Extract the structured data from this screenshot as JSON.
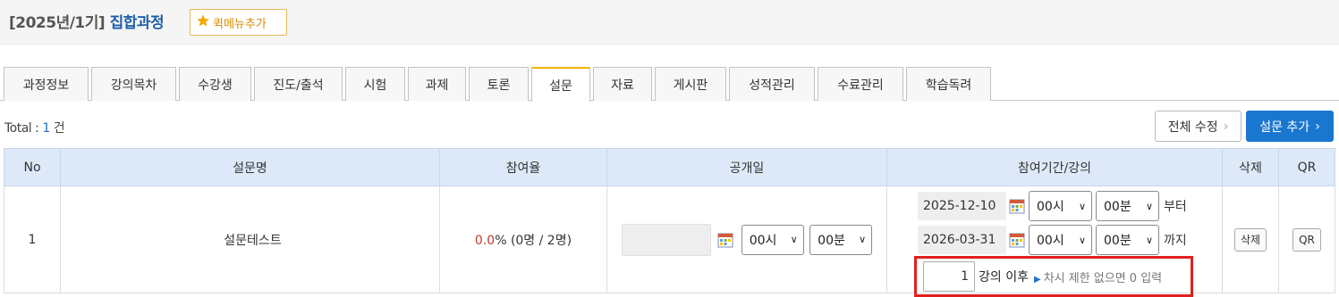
{
  "header": {
    "term": "[2025년/1기]",
    "course": "집합과정",
    "quick_menu_label": "퀵메뉴추가"
  },
  "tabs": [
    {
      "label": "과정정보",
      "active": false
    },
    {
      "label": "강의목차",
      "active": false
    },
    {
      "label": "수강생",
      "active": false
    },
    {
      "label": "진도/출석",
      "active": false
    },
    {
      "label": "시험",
      "active": false
    },
    {
      "label": "과제",
      "active": false
    },
    {
      "label": "토론",
      "active": false
    },
    {
      "label": "설문",
      "active": true
    },
    {
      "label": "자료",
      "active": false
    },
    {
      "label": "게시판",
      "active": false
    },
    {
      "label": "성적관리",
      "active": false
    },
    {
      "label": "수료관리",
      "active": false
    },
    {
      "label": "학습독려",
      "active": false
    }
  ],
  "summary": {
    "total_prefix": "Total : ",
    "total_count": "1",
    "total_unit": " 건",
    "edit_all_label": "전체 수정",
    "add_survey_label": "설문 추가"
  },
  "table": {
    "headers": {
      "no": "No",
      "name": "설문명",
      "rate": "참여율",
      "open_date": "공개일",
      "period": "참여기간/강의",
      "delete": "삭제",
      "qr": "QR"
    },
    "rows": [
      {
        "no": "1",
        "name": "설문테스트",
        "rate_pct": "0.0",
        "rate_rest": "% (0명 / 2명)",
        "open_date": "",
        "open_hour": "00시",
        "open_minute": "00분",
        "start_date": "2025-12-10",
        "start_hour": "00시",
        "start_minute": "00분",
        "start_suffix": "부터",
        "end_date": "2026-03-31",
        "end_hour": "00시",
        "end_minute": "00분",
        "end_suffix": "까지",
        "lecture_value": "1",
        "lecture_after": "강의 이후",
        "lecture_hint": "차시 제한 없으면 0 입력",
        "delete_label": "삭제",
        "qr_label": "QR"
      }
    ]
  },
  "colors": {
    "accent_blue": "#1a77d0",
    "active_tab": "#f0b400",
    "highlight_box": "#e02020"
  }
}
